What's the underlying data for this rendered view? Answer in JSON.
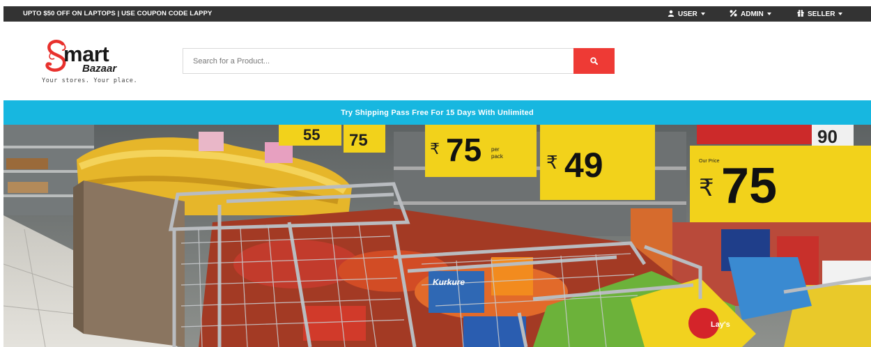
{
  "topbar": {
    "promo": "UPTO $50 OFF ON LAPTOPS | USE COUPON CODE LAPPY",
    "menus": [
      {
        "label": "USER",
        "icon": "user-icon"
      },
      {
        "label": "ADMIN",
        "icon": "percent-icon"
      },
      {
        "label": "SELLER",
        "icon": "gift-icon"
      }
    ]
  },
  "logo": {
    "word": "mart",
    "sub": "Bazaar",
    "tagline": "Your stores. Your place."
  },
  "search": {
    "placeholder": "Search for a Product...",
    "button_icon": "search-icon"
  },
  "shipping_banner": "Try Shipping Pass Free For 15 Days With Unlimited",
  "hero": {
    "description_icon": "supermarket-photo",
    "price_tags": [
      {
        "currency": "₹",
        "value": "75",
        "note": "per pack"
      },
      {
        "currency": "₹",
        "value": "49"
      },
      {
        "currency": "₹",
        "value": "75",
        "note": "Our Price"
      },
      {
        "value": "90"
      }
    ]
  },
  "colors": {
    "topbar": "#333333",
    "accent_red": "#ee3a35",
    "banner_blue": "#17b7e0"
  }
}
